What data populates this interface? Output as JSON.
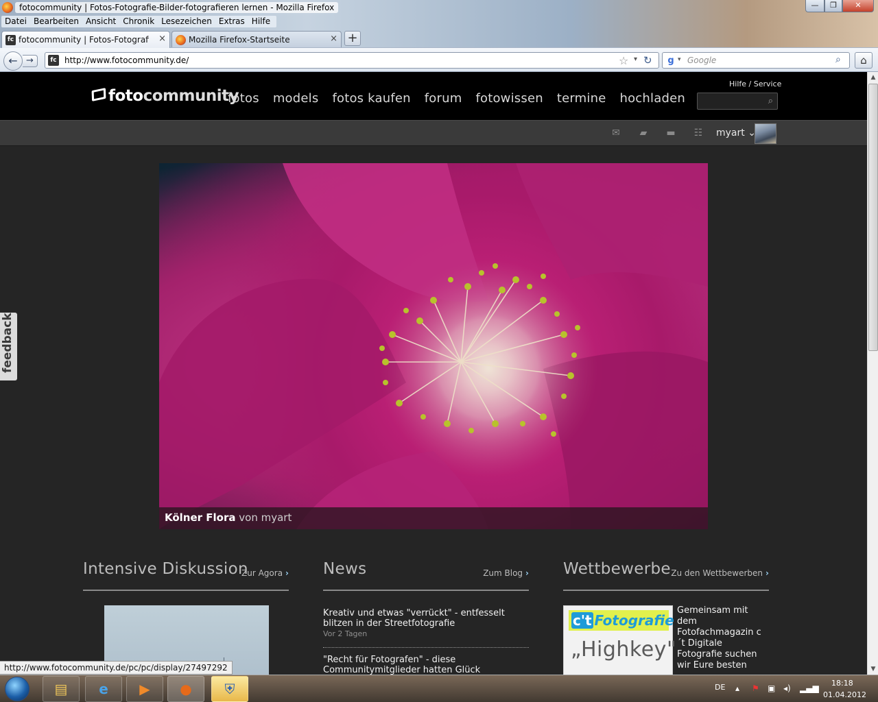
{
  "window": {
    "title": "fotocommunity | Fotos-Fotografie-Bilder-fotografieren lernen - Mozilla Firefox",
    "menu": [
      "Datei",
      "Bearbeiten",
      "Ansicht",
      "Chronik",
      "Lesezeichen",
      "Extras",
      "Hilfe"
    ],
    "controls": {
      "minimize": "—",
      "maximize": "❐",
      "close": "✕"
    }
  },
  "tabs": [
    {
      "label": "fotocommunity | Fotos-Fotografie-Bil...",
      "close": "×",
      "favicon": "fc"
    },
    {
      "label": "Mozilla Firefox-Startseite",
      "close": "×",
      "favicon": "firefox"
    }
  ],
  "new_tab_label": "+",
  "nav": {
    "back": "←",
    "forward": "→",
    "url": "http://www.fotocommunity.de/",
    "url_favicon": "fc",
    "search_placeholder": "Google",
    "search_engine_glyph": "g"
  },
  "site": {
    "logo": {
      "part1": "foto",
      "part2": "community"
    },
    "nav": [
      "fotos",
      "models",
      "fotos kaufen",
      "forum",
      "fotowissen",
      "termine",
      "hochladen"
    ],
    "help_link": "Hilfe / Service",
    "user_name": "myart",
    "user_chevron": "⌄",
    "icons": [
      "mail-icon",
      "folder-icon",
      "chat-icon",
      "group-icon"
    ]
  },
  "hero": {
    "photo_title": "Kölner Flora",
    "photo_by": "von",
    "photo_author": "myart"
  },
  "sections": {
    "diskussion": {
      "title": "Intensive Diskussion",
      "link": "Zur Agora"
    },
    "news": {
      "title": "News",
      "link": "Zum Blog",
      "items": [
        {
          "title": "Kreativ und etwas \"verrückt\" - entfesselt blitzen in der Streetfotografie",
          "meta": "Vor 2 Tagen"
        },
        {
          "title": "\"Recht für Fotografen\" - diese Communitymitglieder hatten Glück",
          "meta": ""
        }
      ]
    },
    "wettbewerbe": {
      "title": "Wettbewerbe",
      "link": "Zu den Wettbewerben",
      "badge_ct": "c't",
      "badge_text": "Fotografie",
      "image_word": "„Highkey\"",
      "text": "Gemeinsam mit dem Fotofachmagazin c´t Digitale Fotografie suchen wir Eure besten"
    }
  },
  "feedback_label": "feedback",
  "status_url": "http://www.fotocommunity.de/pc/pc/display/27497292",
  "taskbar": {
    "lang": "DE",
    "time": "18:18",
    "date": "01.04.2012"
  },
  "colors": {
    "page_bg": "#252525",
    "header_bg": "#000000",
    "accent_link": "#9ad0f0",
    "flower_magenta": "#b91f74"
  }
}
